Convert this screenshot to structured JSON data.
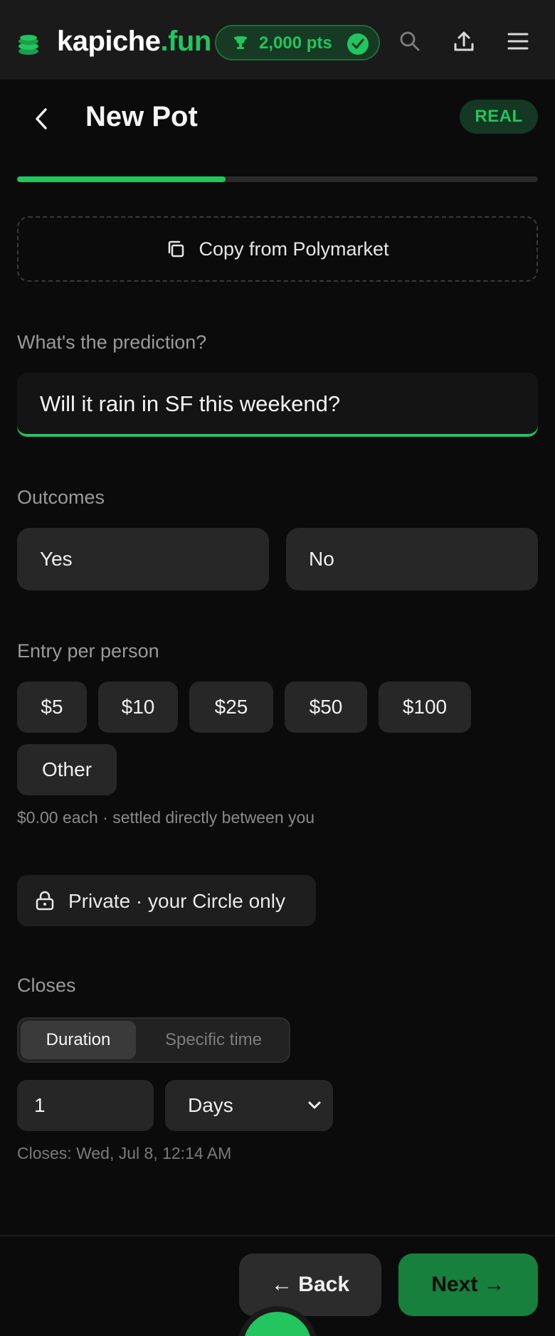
{
  "topbar": {
    "logo_main": "kapiche",
    "logo_accent": ".fun",
    "points": "2,000 pts",
    "icons": [
      "coin-stack-icon",
      "trophy-icon",
      "check-circle-icon",
      "search-icon",
      "share-icon",
      "menu-icon"
    ]
  },
  "header": {
    "title": "New Pot",
    "badge": "REAL"
  },
  "progress": {
    "fraction": 0.4
  },
  "copy_button": {
    "label": "Copy from Polymarket"
  },
  "prediction": {
    "label": "What's the prediction?",
    "value": "Will it rain in SF this weekend?"
  },
  "outcomes": {
    "label": "Outcomes",
    "items": [
      "Yes",
      "No"
    ]
  },
  "entry": {
    "label": "Entry per person",
    "options": [
      "$5",
      "$10",
      "$25",
      "$50",
      "$100",
      "Other"
    ],
    "hint": "$0.00 each · settled directly between you"
  },
  "privacy": {
    "label": "Private · your Circle only"
  },
  "closes": {
    "label": "Closes",
    "modes": [
      "Duration",
      "Specific time"
    ],
    "active_mode": "Duration",
    "amount": "1",
    "unit": "Days",
    "summary": "Closes: Wed, Jul 8, 12:14 AM"
  },
  "footer": {
    "back_label": "← Back",
    "next_label": "Next →"
  },
  "colors": {
    "accent": "#22c55e",
    "background": "#0b0b0b",
    "surface": "#272727"
  }
}
